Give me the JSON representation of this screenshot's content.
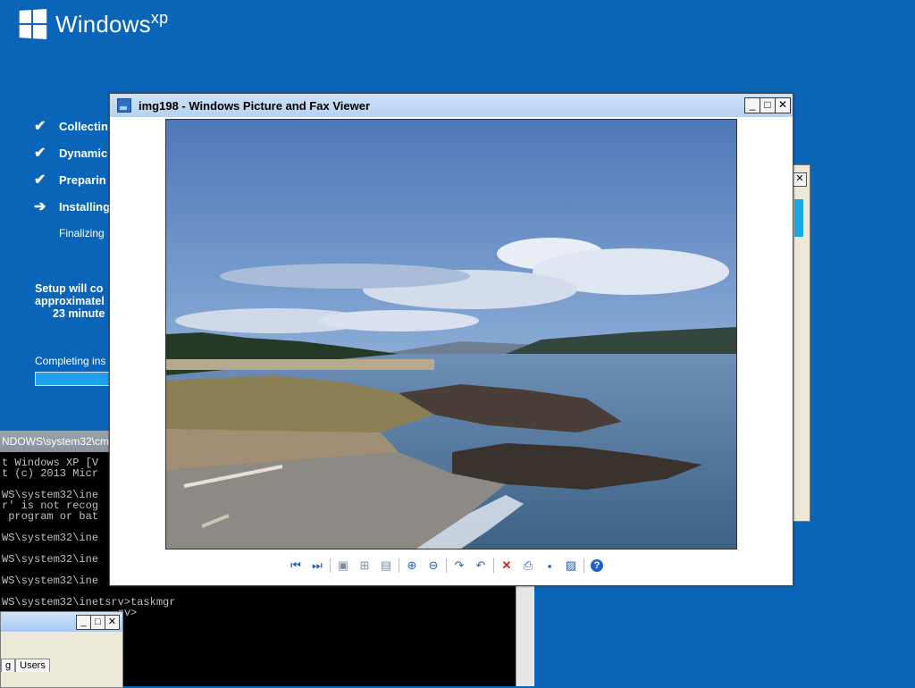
{
  "setup": {
    "logo_text": "Windows",
    "logo_sup": "xp",
    "steps": [
      {
        "mark": "✔",
        "label": "Collectin"
      },
      {
        "mark": "✔",
        "label": "Dynamic"
      },
      {
        "mark": "✔",
        "label": "Preparin"
      },
      {
        "mark": "➔",
        "label": "Installing"
      }
    ],
    "substep": "Finalizing",
    "info_line1": "Setup will co",
    "info_line2": "approximatel",
    "info_line3": "23 minute",
    "progress_label": "Completing ins",
    "progress_fraction": 0.28
  },
  "console": {
    "title": "NDOWS\\system32\\cmd",
    "lines": [
      "t Windows XP [V",
      "t (c) 2013 Micr",
      "",
      "WS\\system32\\ine",
      "r' is not recog",
      " program or bat",
      "",
      "WS\\system32\\ine",
      "",
      "WS\\system32\\ine",
      "",
      "WS\\system32\\ine",
      "",
      "WS\\system32\\inetsrv>taskmgr",
      "                  rv>"
    ]
  },
  "taskmgr": {
    "tab_partial": "g",
    "tab_users": "Users"
  },
  "viewer": {
    "title": "img198 - Windows Picture and Fax Viewer",
    "toolbar": [
      {
        "name": "previous-image-icon",
        "glyph": "⏮"
      },
      {
        "name": "next-image-icon",
        "glyph": "⏭"
      },
      {
        "name": "best-fit-icon",
        "glyph": "▣"
      },
      {
        "name": "actual-size-icon",
        "glyph": "⊞"
      },
      {
        "name": "slideshow-icon",
        "glyph": "▤"
      },
      {
        "name": "zoom-in-icon",
        "glyph": "⊕"
      },
      {
        "name": "zoom-out-icon",
        "glyph": "⊖"
      },
      {
        "name": "rotate-clockwise-icon",
        "glyph": "↷"
      },
      {
        "name": "rotate-counterclockwise-icon",
        "glyph": "↶"
      },
      {
        "name": "delete-icon",
        "glyph": "✕"
      },
      {
        "name": "print-icon",
        "glyph": "⎙"
      },
      {
        "name": "save-icon",
        "glyph": "▪"
      },
      {
        "name": "edit-icon",
        "glyph": "▨"
      },
      {
        "name": "help-icon",
        "glyph": "?"
      }
    ]
  },
  "colors": {
    "desktop": "#0a64b7",
    "progress": "#1fa0ea"
  }
}
